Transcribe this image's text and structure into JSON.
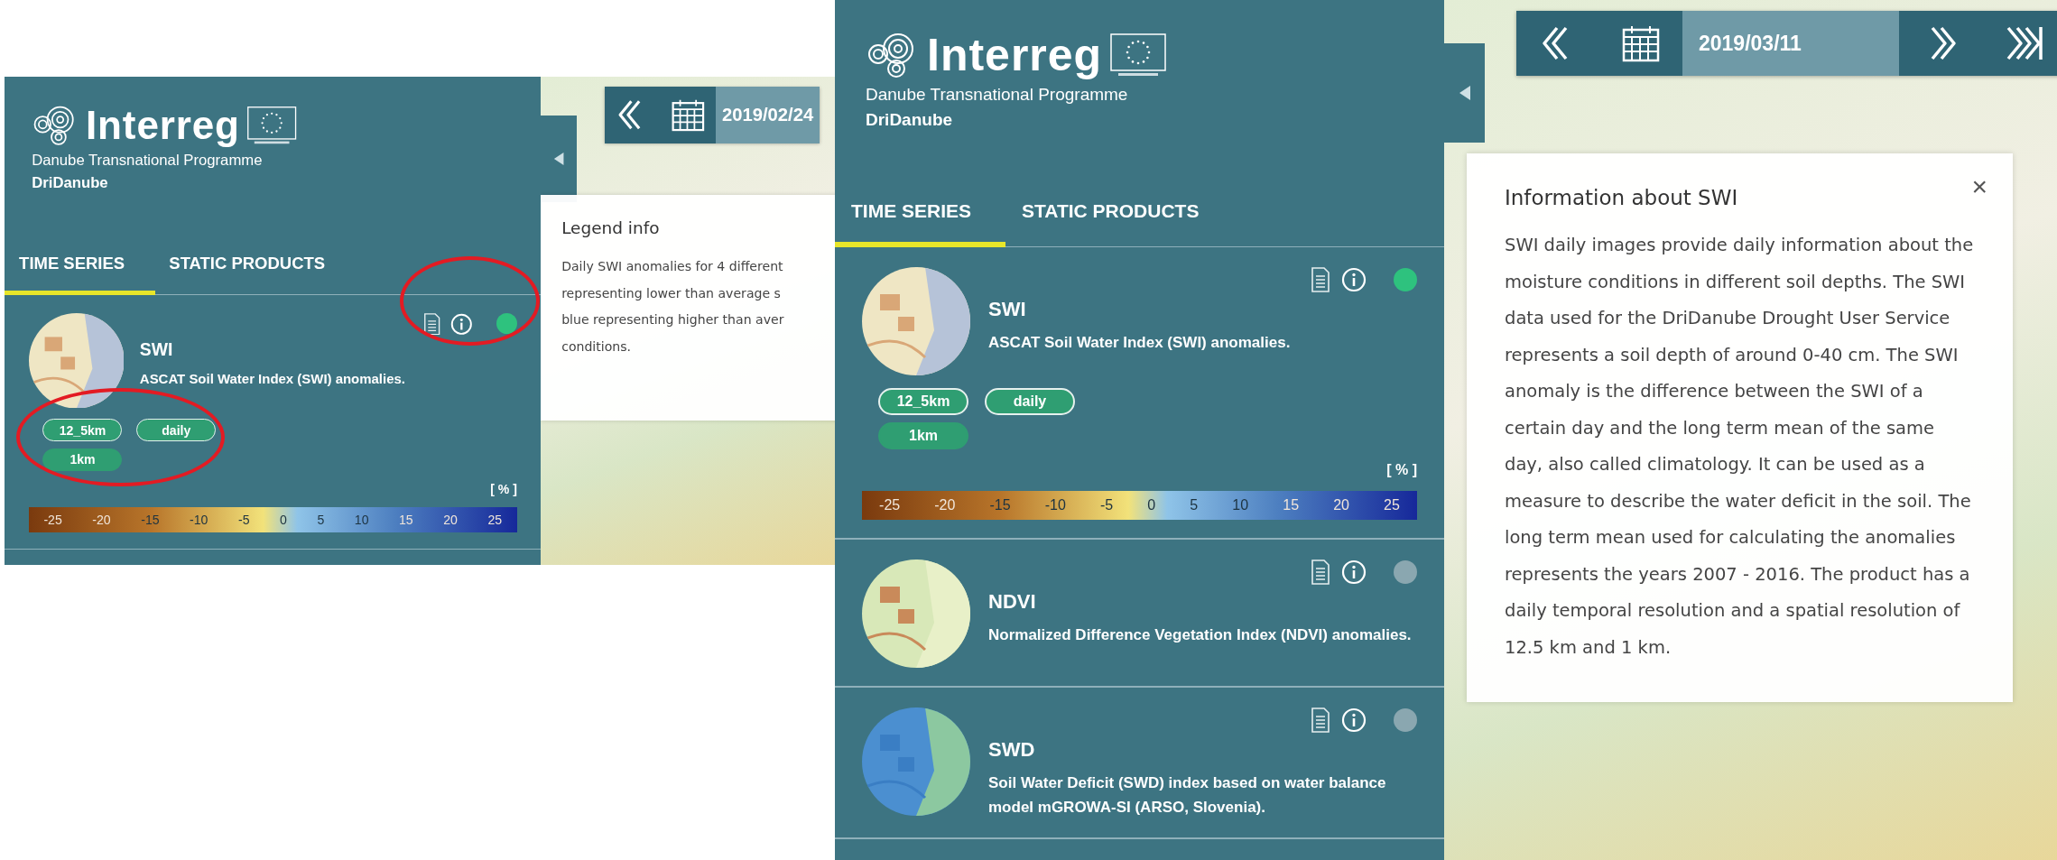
{
  "screenshots": [
    {
      "logo": {
        "wordmark": "Interreg",
        "programme": "Danube Transnational Programme",
        "project": "DriDanube"
      },
      "tabs": [
        {
          "label": "TIME SERIES",
          "selected": true
        },
        {
          "label": "STATIC PRODUCTS",
          "selected": false
        }
      ],
      "products": [
        {
          "name": "SWI",
          "description": "ASCAT Soil Water Index (SWI) anomalies.",
          "active": true,
          "chips": [
            {
              "label": "12_5km",
              "selected": false
            },
            {
              "label": "daily",
              "selected": false
            },
            {
              "label": "1km",
              "selected": true
            }
          ],
          "legend": {
            "unit": "[ % ]",
            "ticks": [
              "-25",
              "-20",
              "-15",
              "-10",
              "-5",
              "0",
              "5",
              "10",
              "15",
              "20",
              "25"
            ]
          }
        }
      ],
      "date_bar": {
        "date": "2019/02/24",
        "has_forward": false
      },
      "info_panel": {
        "kind": "legend",
        "title": "Legend info",
        "lines": [
          "Daily SWI anomalies for 4 different",
          "representing lower than average s",
          "blue representing higher than aver",
          "conditions."
        ]
      },
      "annotations": [
        {
          "kind": "ellipse"
        },
        {
          "kind": "ellipse"
        }
      ]
    },
    {
      "logo": {
        "wordmark": "Interreg",
        "programme": "Danube Transnational Programme",
        "project": "DriDanube"
      },
      "tabs": [
        {
          "label": "TIME SERIES",
          "selected": true
        },
        {
          "label": "STATIC PRODUCTS",
          "selected": false
        }
      ],
      "products": [
        {
          "name": "SWI",
          "description": "ASCAT Soil Water Index (SWI) anomalies.",
          "active": true,
          "chips": [
            {
              "label": "12_5km",
              "selected": false
            },
            {
              "label": "daily",
              "selected": false
            },
            {
              "label": "1km",
              "selected": true
            }
          ],
          "legend": {
            "unit": "[ % ]",
            "ticks": [
              "-25",
              "-20",
              "-15",
              "-10",
              "-5",
              "0",
              "5",
              "10",
              "15",
              "20",
              "25"
            ]
          }
        },
        {
          "name": "NDVI",
          "description": "Normalized Difference Vegetation Index (NDVI) anomalies.",
          "active": false
        },
        {
          "name": "SWD",
          "description": "Soil Water Deficit (SWD) index based on water balance model mGROWA-SI (ARSO, Slovenia).",
          "active": false
        }
      ],
      "date_bar": {
        "date": "2019/03/11",
        "has_forward": true
      },
      "info_panel": {
        "kind": "info",
        "title": "Information about SWI",
        "text": "SWI daily images provide daily information about the moisture conditions in different soil depths. The SWI data used for the DriDanube Drought User Service represents a soil depth of around 0-40 cm. The SWI anomaly is the difference between the SWI of a certain day and the long term mean of the same day, also called climatology. It can be used as a measure to describe the water deficit in the soil. The long term mean used for calculating the anomalies represents the years 2007 - 2016. The product has a daily temporal resolution and a spatial resolution of 12.5 km and 1 km.",
        "close": "×"
      }
    }
  ]
}
